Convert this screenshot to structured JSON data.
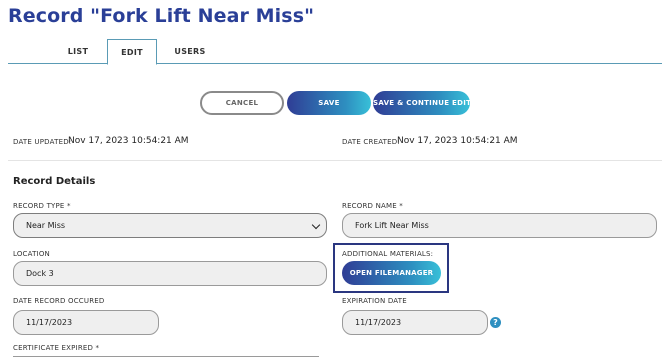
{
  "page": {
    "title": "Record \"Fork Lift Near Miss\""
  },
  "tabs": [
    {
      "label": "LIST"
    },
    {
      "label": "EDIT"
    },
    {
      "label": "USERS"
    }
  ],
  "actions": {
    "cancel_label": "CANCEL",
    "save_label": "SAVE",
    "save_continue_label": "SAVE & CONTINUE EDIT"
  },
  "meta": {
    "updated_label": "DATE UPDATED:",
    "updated_value": "Nov 17, 2023 10:54:21 AM",
    "created_label": "DATE CREATED:",
    "created_value": "Nov 17, 2023 10:54:21 AM"
  },
  "details": {
    "section_title": "Record Details",
    "record_type": {
      "label": "RECORD TYPE *",
      "value": "Near Miss"
    },
    "record_name": {
      "label": "RECORD NAME *",
      "value": "Fork Lift Near Miss"
    },
    "location": {
      "label": "LOCATION",
      "value": "Dock 3"
    },
    "additional_materials": {
      "label": "ADDITIONAL MATERIALS:",
      "button_label": "OPEN FILEMANAGER"
    },
    "date_occurred": {
      "label": "DATE RECORD OCCURED",
      "value": "11/17/2023"
    },
    "expiration_date": {
      "label": "EXPIRATION DATE",
      "value": "11/17/2023",
      "help_glyph": "?"
    },
    "certificate_expired": {
      "label": "CERTIFICATE EXPIRED *"
    }
  },
  "colors": {
    "title": "#2a3f97",
    "accent_start": "#2f3d95",
    "accent_end": "#38c0d8",
    "tab_border": "#5a9bb5",
    "highlight": "#2a3680"
  }
}
